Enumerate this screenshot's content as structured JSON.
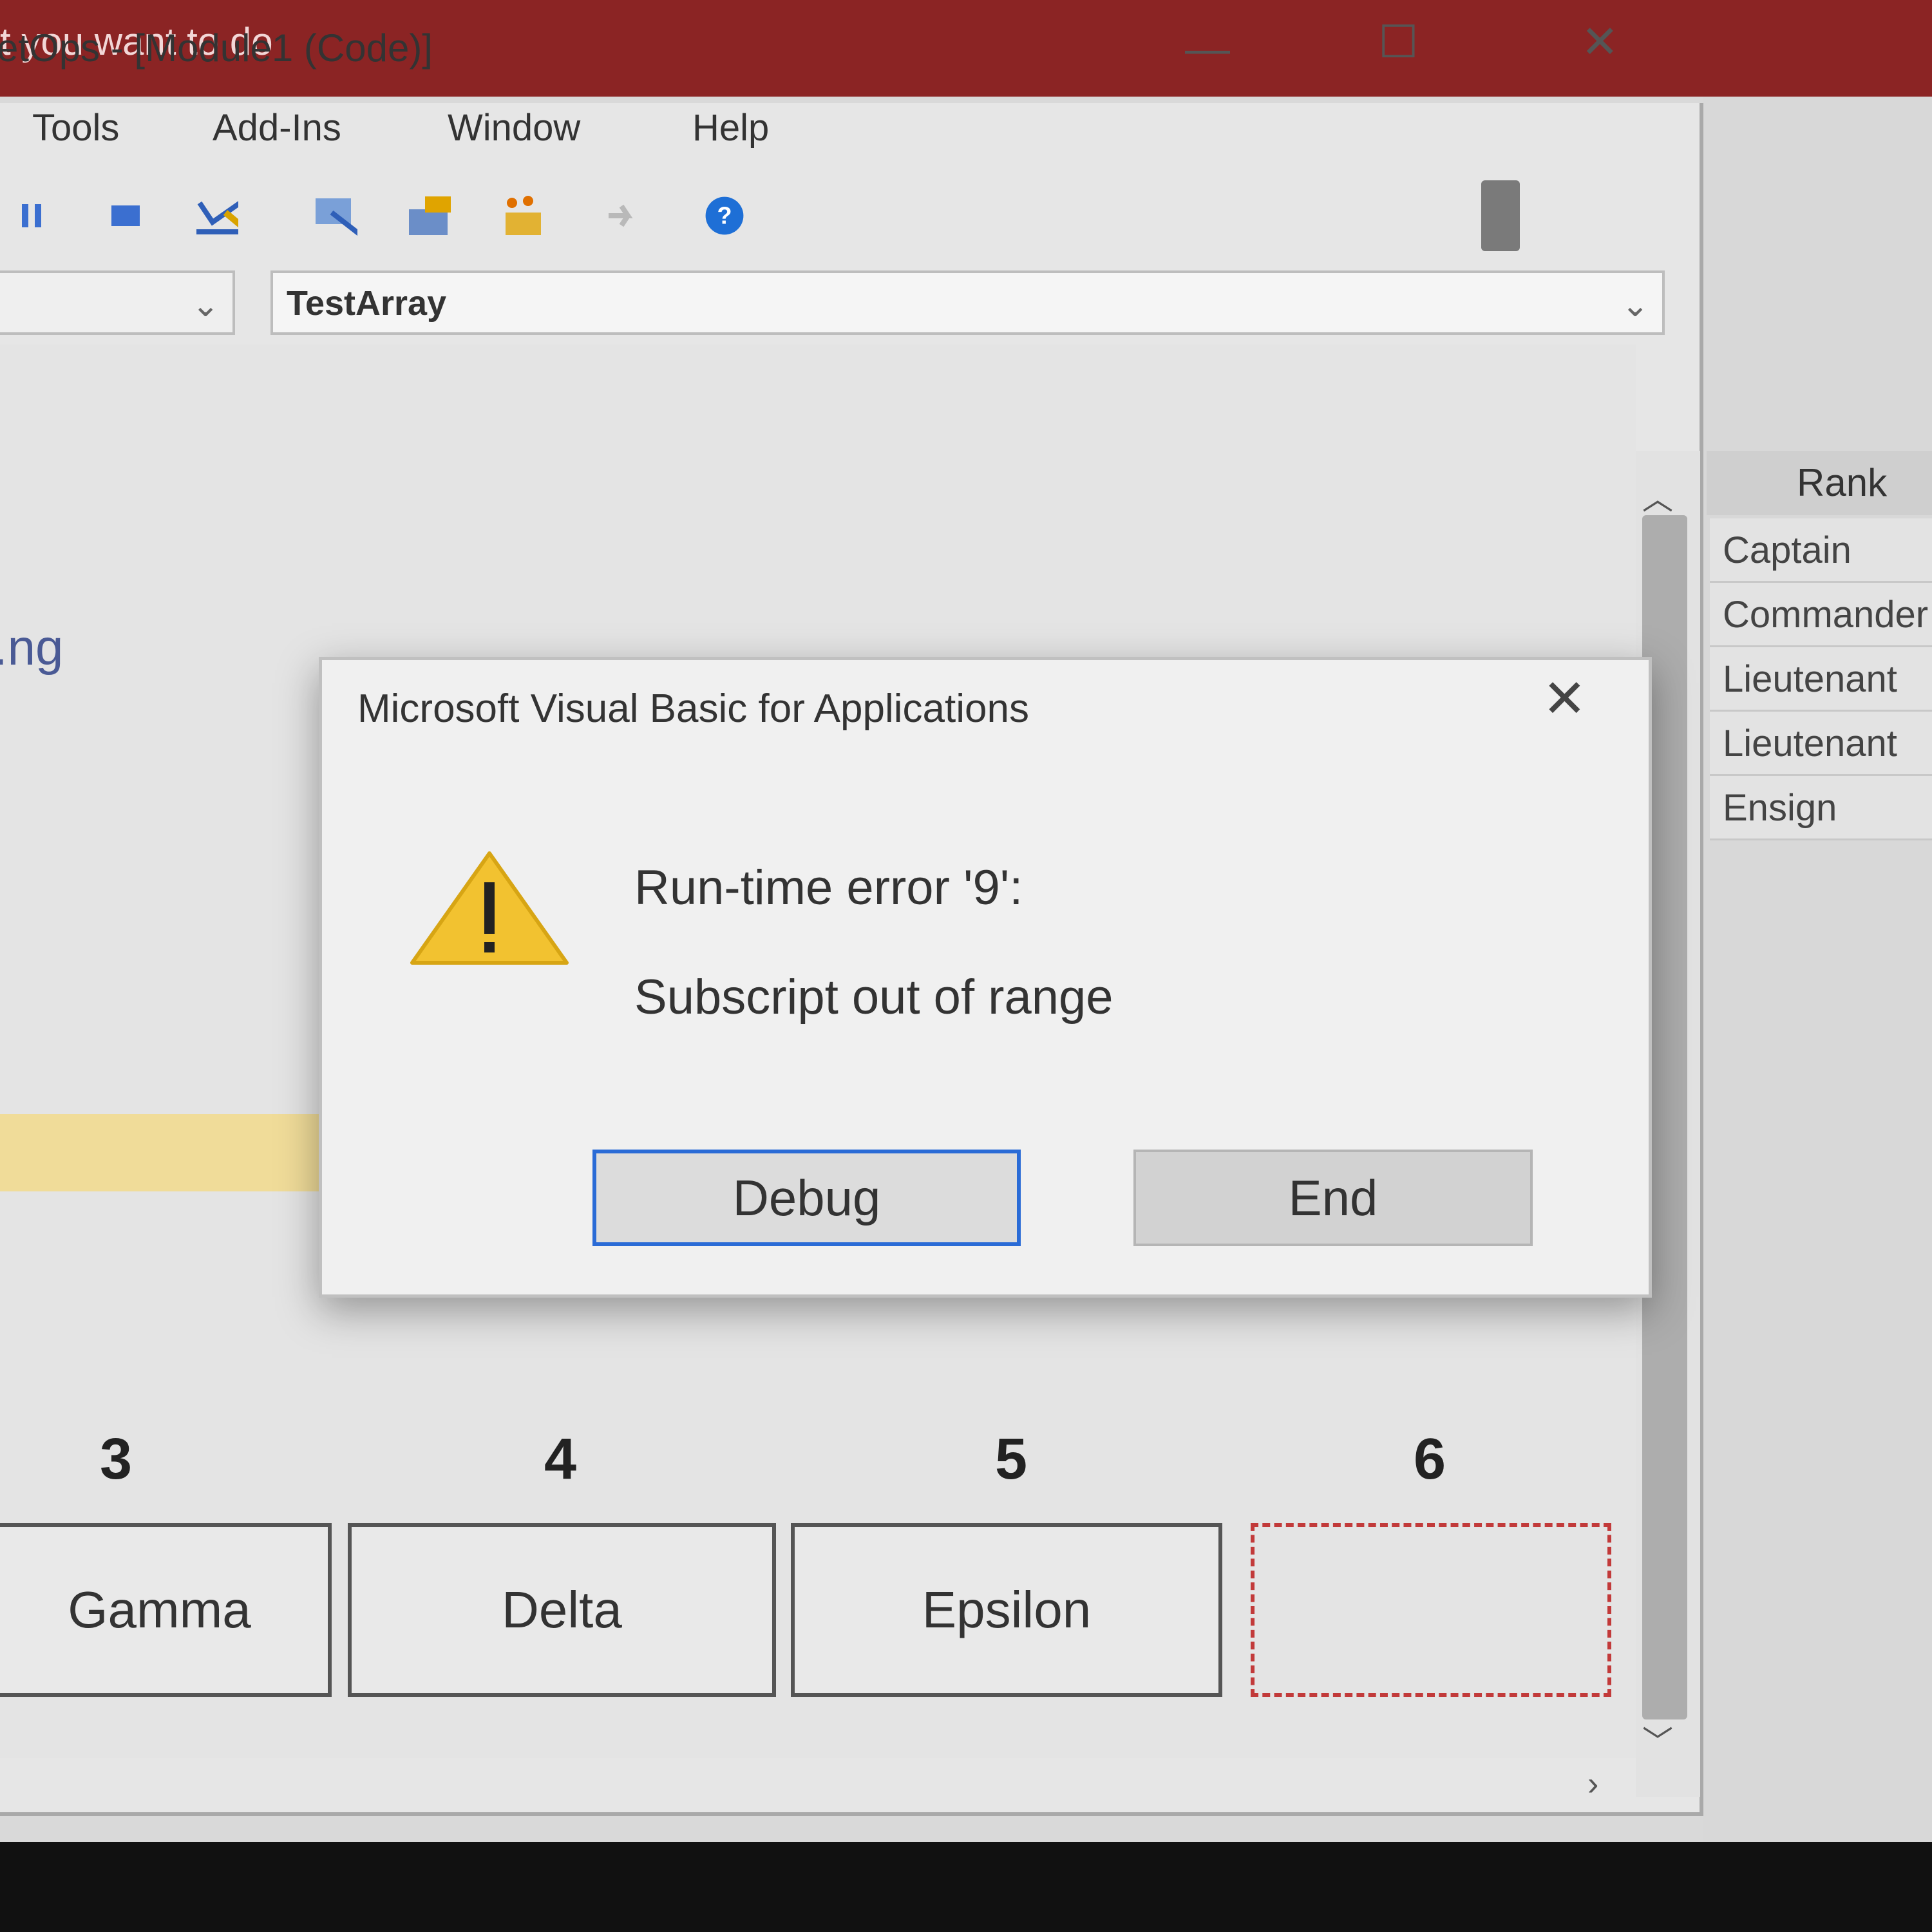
{
  "banner": {
    "text": "t you want to do"
  },
  "window": {
    "title": "etOps - [Module1 (Code)]",
    "minimize": "—",
    "maximize": "☐",
    "close": "✕"
  },
  "menu": [
    {
      "label": "Tools"
    },
    {
      "label": "Add-Ins"
    },
    {
      "label": "Window"
    },
    {
      "label": "Help"
    }
  ],
  "toolbar": {
    "icons": [
      "pause-icon",
      "stop-icon",
      "design-mode-icon",
      "project-explorer-icon",
      "properties-icon",
      "object-browser-icon",
      "toolbox-icon",
      "help-icon"
    ]
  },
  "combos": {
    "object_value": "",
    "procedure_value": "TestArray"
  },
  "code": {
    "fragment": ".ng"
  },
  "array": {
    "indices": [
      "3",
      "4",
      "5",
      "6"
    ],
    "values": [
      "Gamma",
      "Delta",
      "Epsilon",
      ""
    ]
  },
  "rank_list": {
    "header": "Rank",
    "rows": [
      "Captain",
      "Commander",
      "Lieutenant",
      "Lieutenant",
      "Ensign"
    ]
  },
  "dialog": {
    "title": "Microsoft Visual Basic for Applications",
    "close": "✕",
    "error_title": "Run-time error '9':",
    "error_message": "Subscript out of range",
    "debug_label": "Debug",
    "end_label": "End"
  },
  "colors": {
    "banner": "#8b2424",
    "debug_focus": "#2a6bd6",
    "empty_cell_border": "#c23a3a",
    "warning": "#f2c230",
    "highlight": "#f0dc99"
  }
}
